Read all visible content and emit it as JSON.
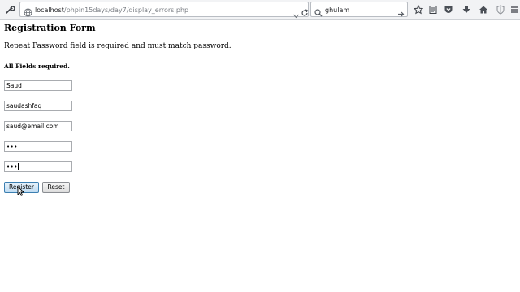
{
  "browser": {
    "url_host": "localhost",
    "url_path": "/phpin15days/day7/display_errors.php",
    "search_value": "ghulam",
    "icons": {
      "tools": "tools-icon",
      "url_site": "globe-icon",
      "url_dropdown": "chevron-down-icon",
      "reload": "reload-icon",
      "search": "search-icon",
      "search_go": "arrow-right-icon",
      "bookmark": "star-icon",
      "reader": "reader-icon",
      "pocket": "pocket-icon",
      "downloads": "download-icon",
      "home": "home-icon",
      "shield": "shield-icon",
      "menu": "menu-icon"
    }
  },
  "page": {
    "title": "Registration Form",
    "error_message": "Repeat Password field is required and must match password.",
    "required_note": "All Fields required."
  },
  "form": {
    "name": {
      "value": "Saud"
    },
    "username": {
      "value": "saudashfaq"
    },
    "email": {
      "value": "saud@email.com"
    },
    "password": {
      "value": "abc"
    },
    "repeat_password": {
      "value": "abc"
    },
    "register_label": "Register",
    "reset_label": "Reset"
  },
  "colors": {
    "primary_button_border": "#3c7fb1",
    "primary_button_fill": "#bfdcf2",
    "toolbar_bg": "#f2f3f5"
  }
}
